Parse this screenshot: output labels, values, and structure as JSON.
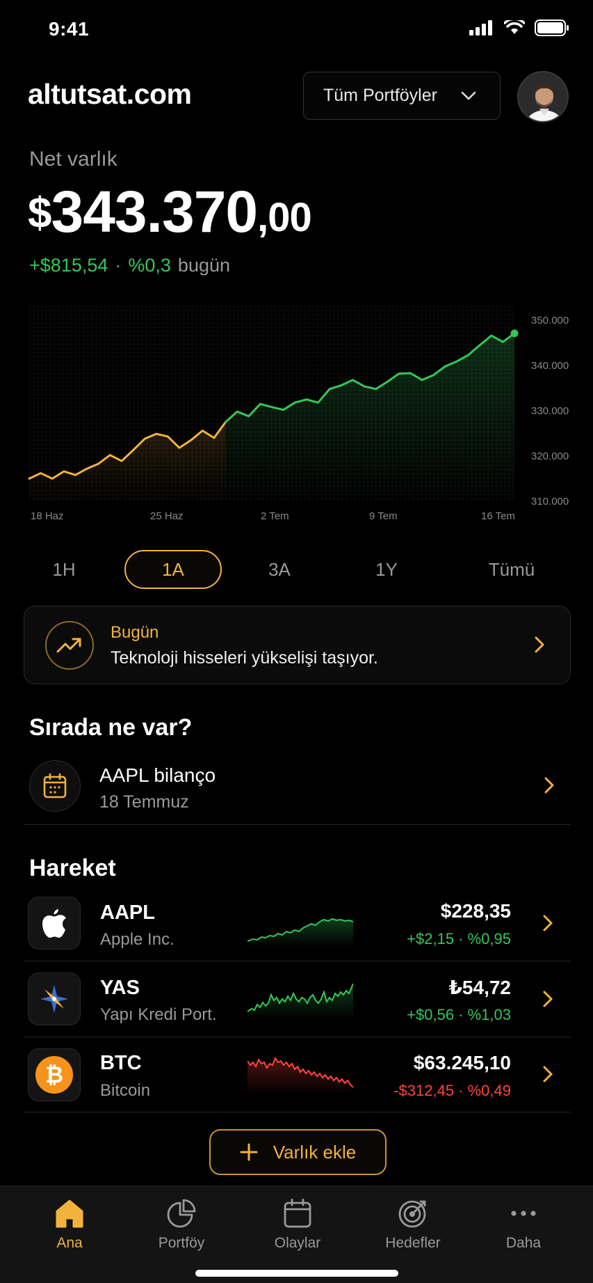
{
  "status_bar": {
    "time": "9:41"
  },
  "header": {
    "brand": "altutsat.com",
    "portfolio_select": {
      "value": "Tüm Portföyler"
    }
  },
  "net_worth": {
    "label": "Net varlık",
    "currency": "$",
    "integer": "343.370",
    "decimal": ",00",
    "change_amount": "+$815,54",
    "separator": "·",
    "change_percent": "%0,3",
    "change_period": "bugün"
  },
  "chart_data": {
    "type": "line",
    "x_ticks": [
      "18 Haz",
      "25 Haz",
      "2 Tem",
      "9 Tem",
      "16 Tem"
    ],
    "y_ticks": [
      "350.000",
      "340.000",
      "330.000",
      "320.000",
      "310.000"
    ],
    "ylim": [
      310000,
      350000
    ],
    "series": [
      {
        "values": [
          315000,
          316200,
          315000,
          316600,
          315800,
          317200,
          318300,
          320200,
          318900,
          321300,
          323800,
          324900,
          324300,
          321800,
          323500,
          325600,
          324000,
          327500,
          329800,
          328800,
          331500,
          330800,
          330200,
          331800,
          332500,
          331800,
          334800,
          335600,
          336800,
          335400,
          334800,
          336400,
          338200,
          338300,
          336800,
          337900,
          339800,
          340900,
          342300,
          344500,
          346600,
          345200,
          347100
        ]
      }
    ],
    "colors": {
      "first_segment": "#f2b33d",
      "second_segment": "#34c759"
    }
  },
  "ranges": [
    {
      "label": "1H",
      "active": false
    },
    {
      "label": "1A",
      "active": true
    },
    {
      "label": "3A",
      "active": false
    },
    {
      "label": "1Y",
      "active": false
    },
    {
      "label": "Tümü",
      "active": false
    }
  ],
  "insight": {
    "title": "Bugün",
    "text": "Teknoloji hisseleri yükselişi taşıyor.",
    "icon": "trending-up-icon"
  },
  "upcoming": {
    "section_title": "Sırada ne var?",
    "item": {
      "title": "AAPL bilanço",
      "date": "18 Temmuz",
      "icon": "calendar-icon"
    }
  },
  "holdings": {
    "section_title": "Hareket",
    "items": [
      {
        "ticker": "AAPL",
        "name": "Apple Inc.",
        "price": "$228,35",
        "change": "+$2,15 · %0,95",
        "trend": "up",
        "icon": "apple-logo-icon"
      },
      {
        "ticker": "YAS",
        "name": "Yapı Kredi Port.",
        "price": "₺54,72",
        "change": "+$0,56 · %1,03",
        "trend": "up",
        "icon": "compass-star-icon"
      },
      {
        "ticker": "BTC",
        "name": "Bitcoin",
        "price": "$63.245,10",
        "change": "-$312,45 · %0,49",
        "trend": "down",
        "icon": "bitcoin-icon"
      }
    ]
  },
  "add_button": {
    "label": "Varlık ekle"
  },
  "tabbar": [
    {
      "label": "Ana",
      "icon": "home-icon",
      "active": true
    },
    {
      "label": "Portföy",
      "icon": "pie-chart-icon",
      "active": false
    },
    {
      "label": "Olaylar",
      "icon": "calendar-icon",
      "active": false
    },
    {
      "label": "Hedefler",
      "icon": "target-icon",
      "active": false
    },
    {
      "label": "Daha",
      "icon": "more-icon",
      "active": false
    }
  ],
  "colors": {
    "accent": "#f2b33d",
    "positive": "#34c759",
    "negative": "#ff453a",
    "background": "#000000"
  }
}
